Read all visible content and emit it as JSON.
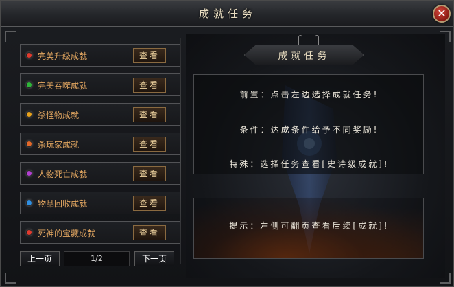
{
  "window": {
    "title": "成就任务",
    "close_label": "✕"
  },
  "achievements": [
    {
      "label": "完美升级成就",
      "dot_color": "#e23b2f",
      "button": "查看"
    },
    {
      "label": "完美吞噬成就",
      "dot_color": "#2fb53a",
      "button": "查看"
    },
    {
      "label": "杀怪物成就",
      "dot_color": "#e8a21c",
      "button": "查看"
    },
    {
      "label": "杀玩家成就",
      "dot_color": "#e2682a",
      "button": "查看"
    },
    {
      "label": "人物死亡成就",
      "dot_color": "#b23fd2",
      "button": "查看"
    },
    {
      "label": "物品回收成就",
      "dot_color": "#2f8fe2",
      "button": "查看"
    },
    {
      "label": "死神的宝藏成就",
      "dot_color": "#e23b2f",
      "button": "查看"
    }
  ],
  "pager": {
    "prev": "上一页",
    "indicator": "1/2",
    "next": "下一页"
  },
  "detail": {
    "header": "成就任务",
    "line1": "前置：点击左边选择成就任务!",
    "line2": "条件：达成条件给予不同奖励!",
    "line3": "特殊：选择任务查看[史诗级成就]!",
    "tip": "提示：左侧可翻页查看后续[成就]!"
  },
  "colors": {
    "item_text": "#e0a560",
    "button_text": "#f0d4a0",
    "title_text": "#e8dcc0"
  }
}
